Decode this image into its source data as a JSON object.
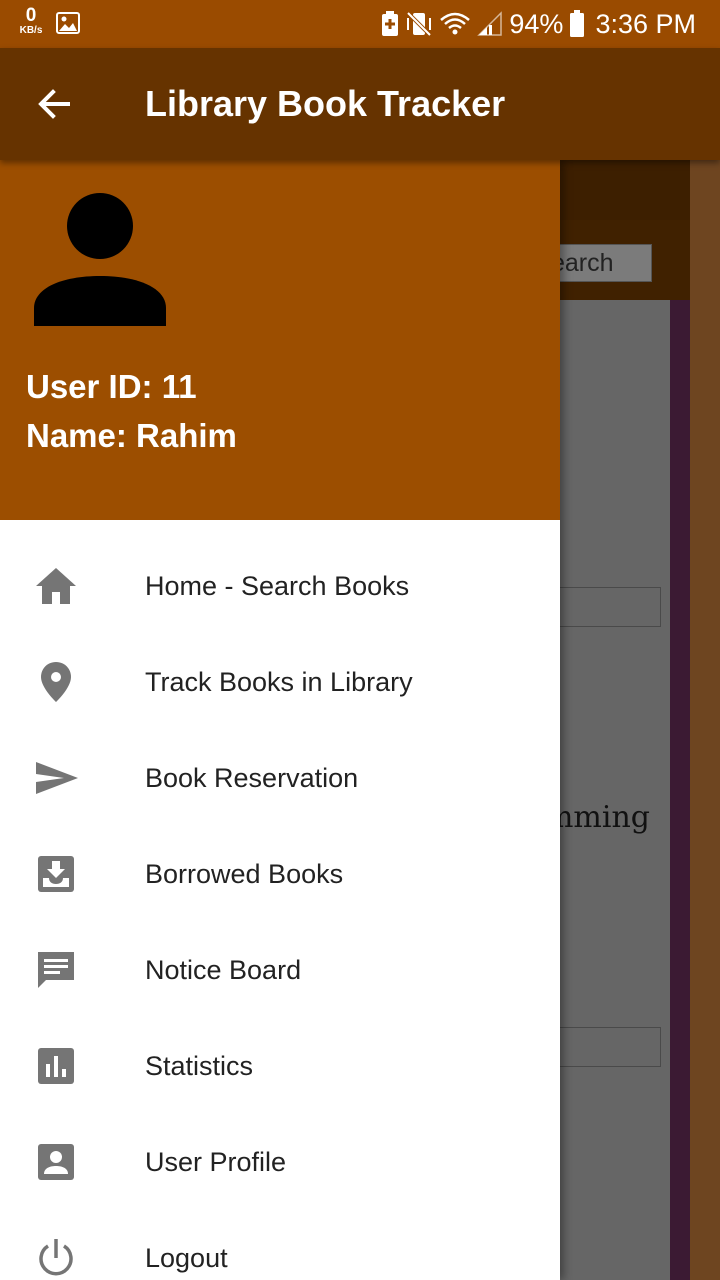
{
  "status_bar": {
    "net_speed_value": "0",
    "net_speed_unit": "KB/s",
    "battery": "94%",
    "time": "3:36 PM"
  },
  "app_bar": {
    "title": "Library Book Tracker",
    "back_icon": "arrow-back-icon"
  },
  "background": {
    "search_fragment": "earch",
    "text_fragment": "amming"
  },
  "drawer": {
    "user_id": "User ID: 11",
    "user_name": "Name: Rahim",
    "items": [
      {
        "label": "Home - Search Books",
        "icon": "home-icon"
      },
      {
        "label": "Track Books in Library",
        "icon": "location-pin-icon"
      },
      {
        "label": "Book Reservation",
        "icon": "send-icon"
      },
      {
        "label": "Borrowed Books",
        "icon": "inbox-download-icon"
      },
      {
        "label": "Notice Board",
        "icon": "message-icon"
      },
      {
        "label": "Statistics",
        "icon": "bar-chart-icon"
      },
      {
        "label": "User Profile",
        "icon": "account-box-icon"
      },
      {
        "label": "Logout",
        "icon": "power-icon"
      }
    ]
  },
  "colors": {
    "status_bar": "#9a4b00",
    "app_bar": "#663300",
    "drawer_header": "#9c4e00",
    "icon_gray": "#757575"
  }
}
